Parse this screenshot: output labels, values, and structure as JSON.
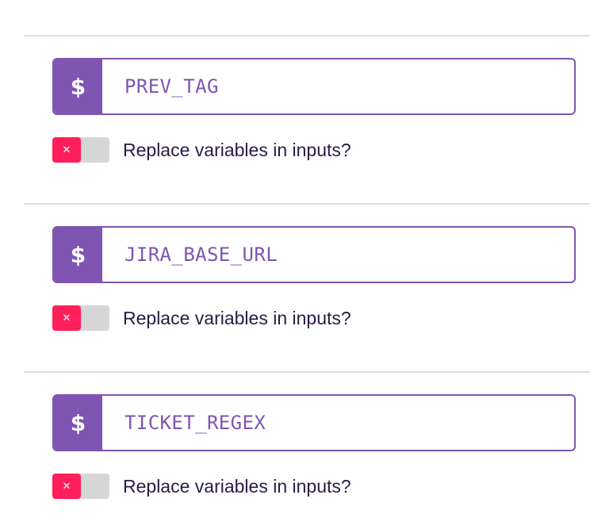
{
  "variables": [
    {
      "name": "PREV_TAG",
      "prefix_symbol": "$",
      "replace_toggle": {
        "checked": false,
        "icon": "x-icon"
      },
      "replace_label": "Replace variables in inputs?"
    },
    {
      "name": "JIRA_BASE_URL",
      "prefix_symbol": "$",
      "replace_toggle": {
        "checked": false,
        "icon": "x-icon"
      },
      "replace_label": "Replace variables in inputs?"
    },
    {
      "name": "TICKET_REGEX",
      "prefix_symbol": "$",
      "replace_toggle": {
        "checked": false,
        "icon": "x-icon"
      },
      "replace_label": "Replace variables in inputs?"
    }
  ],
  "colors": {
    "accent": "#7f54b3",
    "toggle_off": "#ff1f5a",
    "toggle_track": "#d6d6d6",
    "label_text": "#2a1a44",
    "divider": "#dcdcdc"
  }
}
